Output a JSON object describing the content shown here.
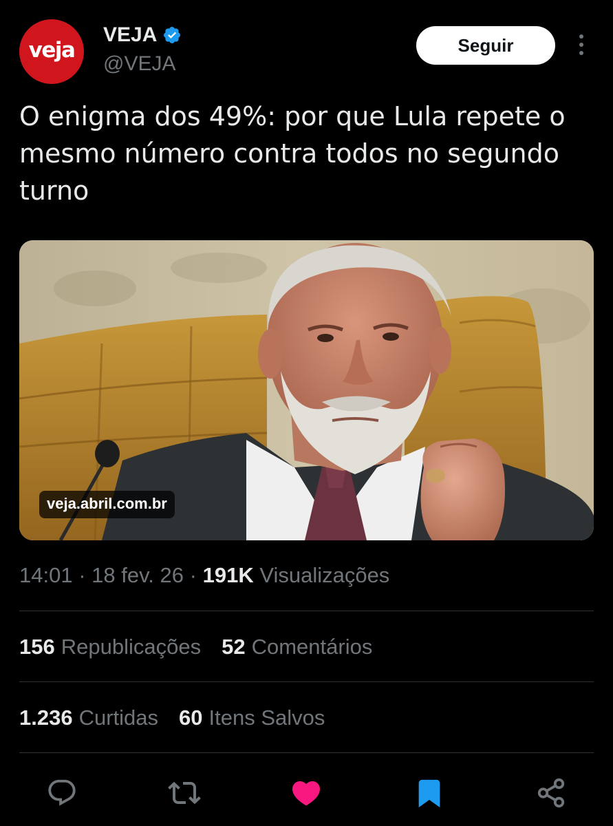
{
  "author": {
    "avatar_text": "veja",
    "display_name": "VEJA",
    "handle": "@VEJA"
  },
  "follow_label": "Seguir",
  "tweet": {
    "text": "O enigma dos 49%: por que Lula repete o mesmo número contra todos no segundo turno"
  },
  "media": {
    "domain": "veja.abril.com.br"
  },
  "meta": {
    "time": "14:01",
    "date": "18 fev. 26",
    "views_count": "191K",
    "views_label": "Visualizações",
    "separator": "·"
  },
  "stats": {
    "reposts_count": "156",
    "reposts_label": "Republicações",
    "comments_count": "52",
    "comments_label": "Comentários",
    "likes_count": "1.236",
    "likes_label": "Curtidas",
    "saves_count": "60",
    "saves_label": "Itens Salvos"
  },
  "actions": {
    "reply_icon": "reply-icon",
    "repost_icon": "repost-icon",
    "like_icon": "like-icon",
    "bookmark_icon": "bookmark-icon",
    "share_icon": "share-icon"
  },
  "colors": {
    "background": "#000000",
    "primary_text": "#e7e9ea",
    "secondary_text": "#71767b",
    "verified": "#1d9bf0",
    "like": "#f91880",
    "bookmark": "#1d9bf0",
    "brand": "#d0161c"
  }
}
